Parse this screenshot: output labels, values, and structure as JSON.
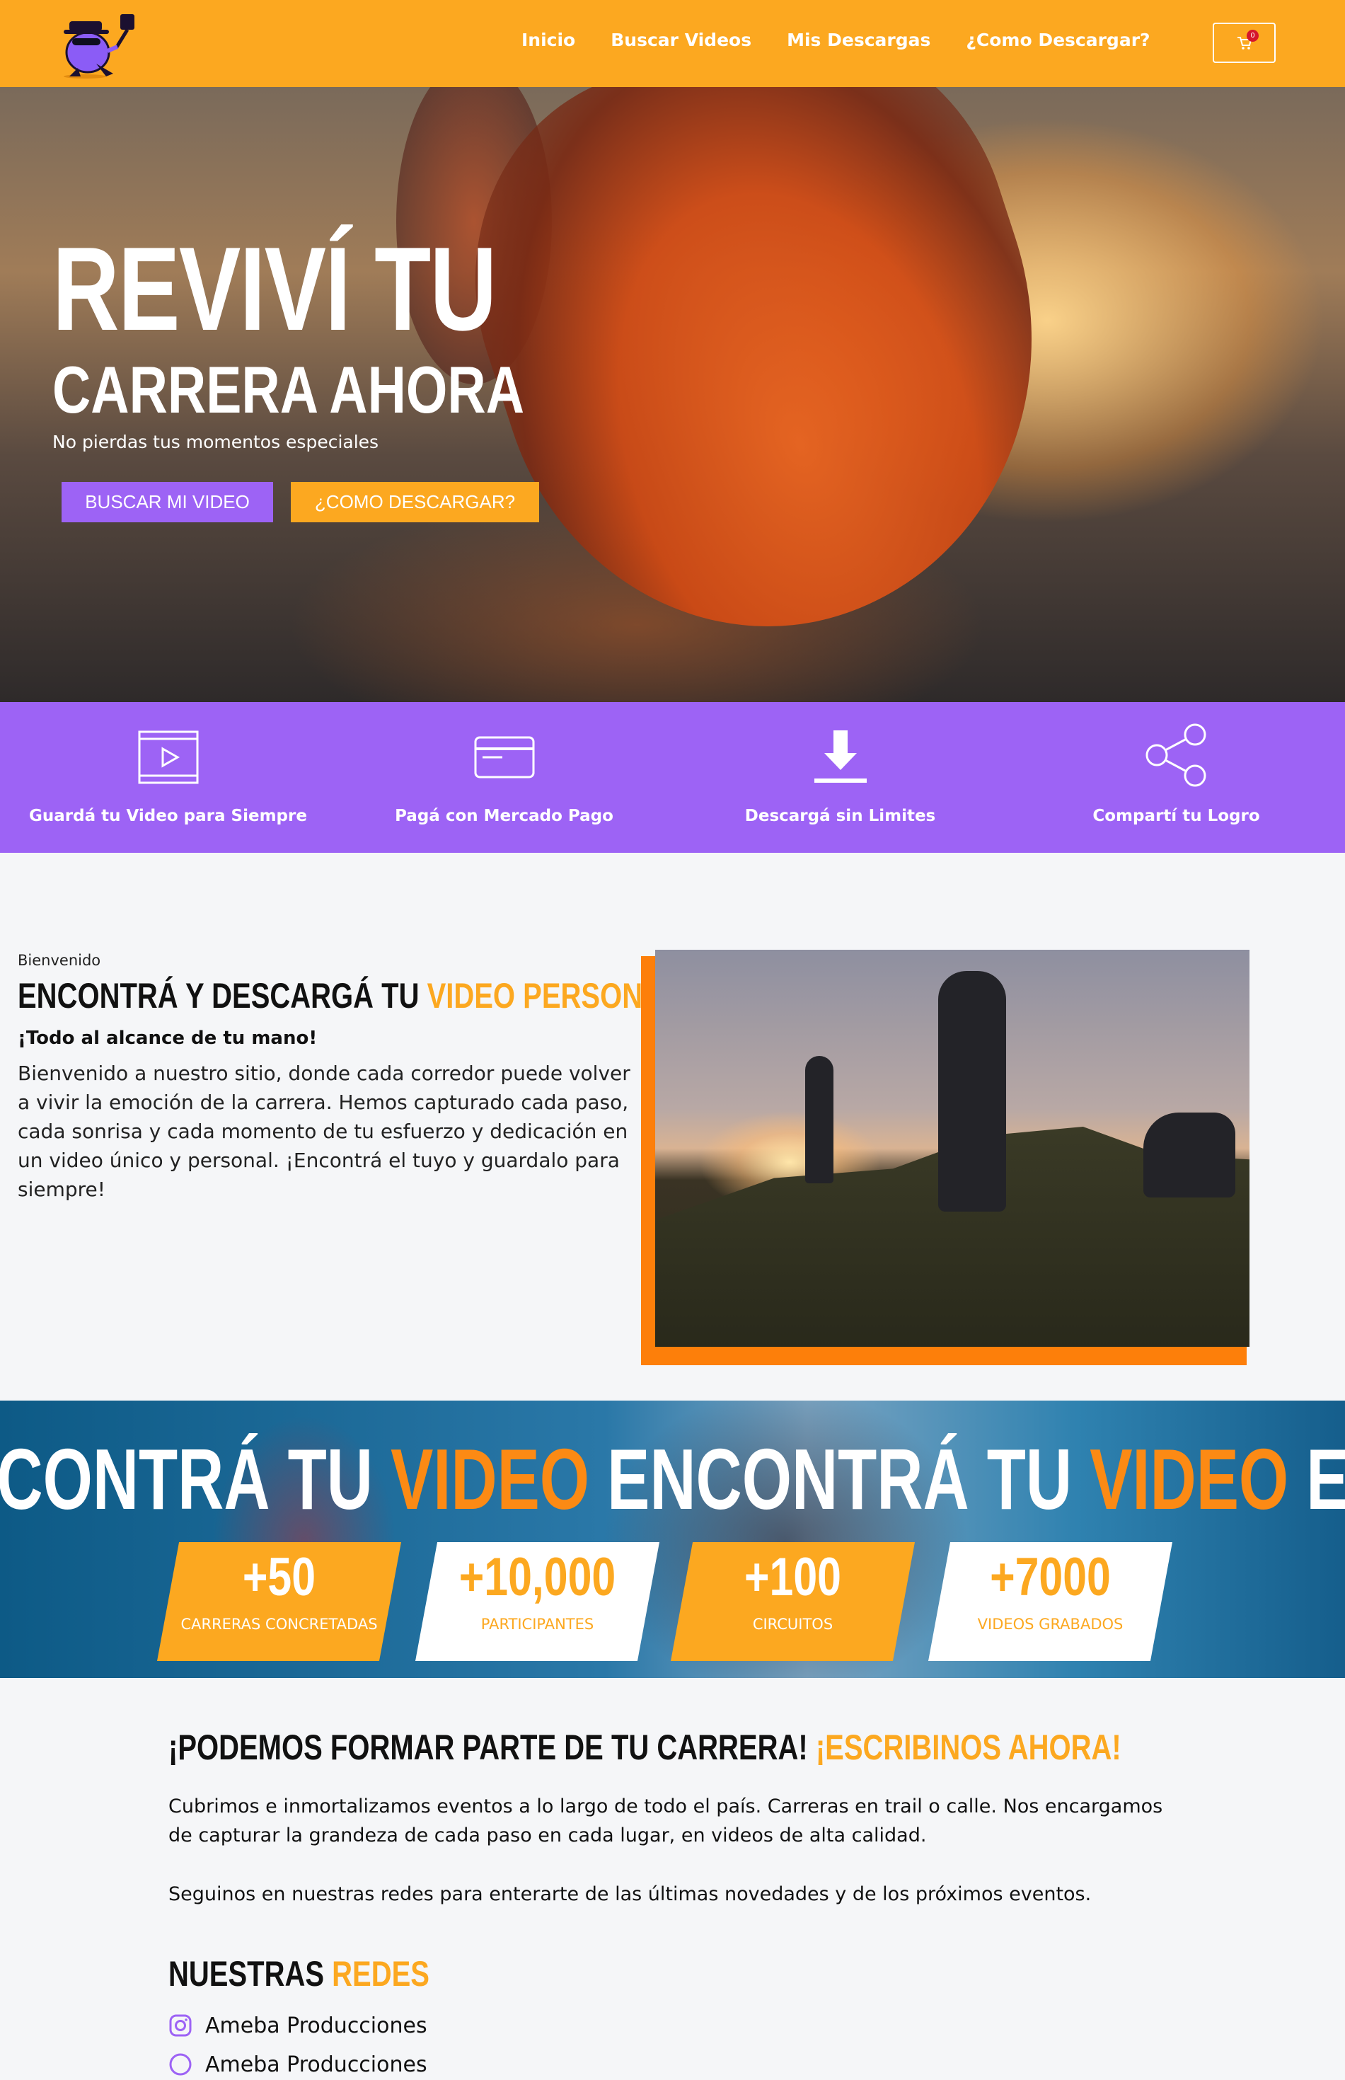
{
  "header": {
    "nav": [
      "Inicio",
      "Buscar Videos",
      "Mis Descargas",
      "¿Como Descargar?"
    ],
    "cart_count": "0",
    "brand_color": "#fca820"
  },
  "hero": {
    "title_line1": "REVIVÍ TU",
    "title_line2": "CARRERA AHORA",
    "subtitle": "No pierdas tus momentos especiales",
    "btn_primary": "BUSCAR MI VIDEO",
    "btn_secondary": "¿COMO DESCARGAR?"
  },
  "features": [
    {
      "icon": "video-icon",
      "label": "Guardá tu Video para Siempre"
    },
    {
      "icon": "credit-card-icon",
      "label": "Pagá con Mercado Pago"
    },
    {
      "icon": "download-icon",
      "label": "Descargá sin Limites"
    },
    {
      "icon": "share-icon",
      "label": "Compartí tu Logro"
    }
  ],
  "about": {
    "kicker": "Bienvenido",
    "title_main": "ENCONTRÁ Y DESCARGÁ TU ",
    "title_accent": "VIDEO PERSONALIZADO",
    "strong": "¡Todo al alcance de tu mano!",
    "text": "Bienvenido a nuestro sitio, donde cada corredor puede volver a vivir la emoción de la carrera. Hemos capturado cada paso, cada sonrisa y cada momento de tu esfuerzo y dedicación en un video único y personal. ¡Encontrá el tuyo y guardalo para siempre!"
  },
  "banner": {
    "marquee_white": "ENCONTRÁ TU ",
    "marquee_orange": "VIDEO",
    "stats": [
      {
        "value": "+50",
        "caption": "CARRERAS CONCRETADAS"
      },
      {
        "value": "+10,000",
        "caption": "PARTICIPANTES"
      },
      {
        "value": "+100",
        "caption": "CIRCUITOS"
      },
      {
        "value": "+7000",
        "caption": "VIDEOS GRABADOS"
      }
    ]
  },
  "contact": {
    "title_main": "¡PODEMOS FORMAR PARTE DE TU CARRERA! ",
    "title_accent": "¡ESCRIBINOS AHORA!",
    "p1": "Cubrimos e inmortalizamos eventos a lo largo de todo el país. Carreras en trail o calle. Nos encargamos de capturar la grandeza de cada paso en cada lugar, en videos de alta calidad.",
    "p2": "Seguinos en nuestras redes para enterarte de las últimas novedades y de los próximos eventos.",
    "redes_main": "NUESTRAS ",
    "redes_accent": "REDES",
    "social": [
      {
        "icon": "instagram-icon",
        "label": "Ameba Producciones"
      },
      {
        "icon": "facebook-icon",
        "label": "Ameba Producciones"
      }
    ]
  }
}
